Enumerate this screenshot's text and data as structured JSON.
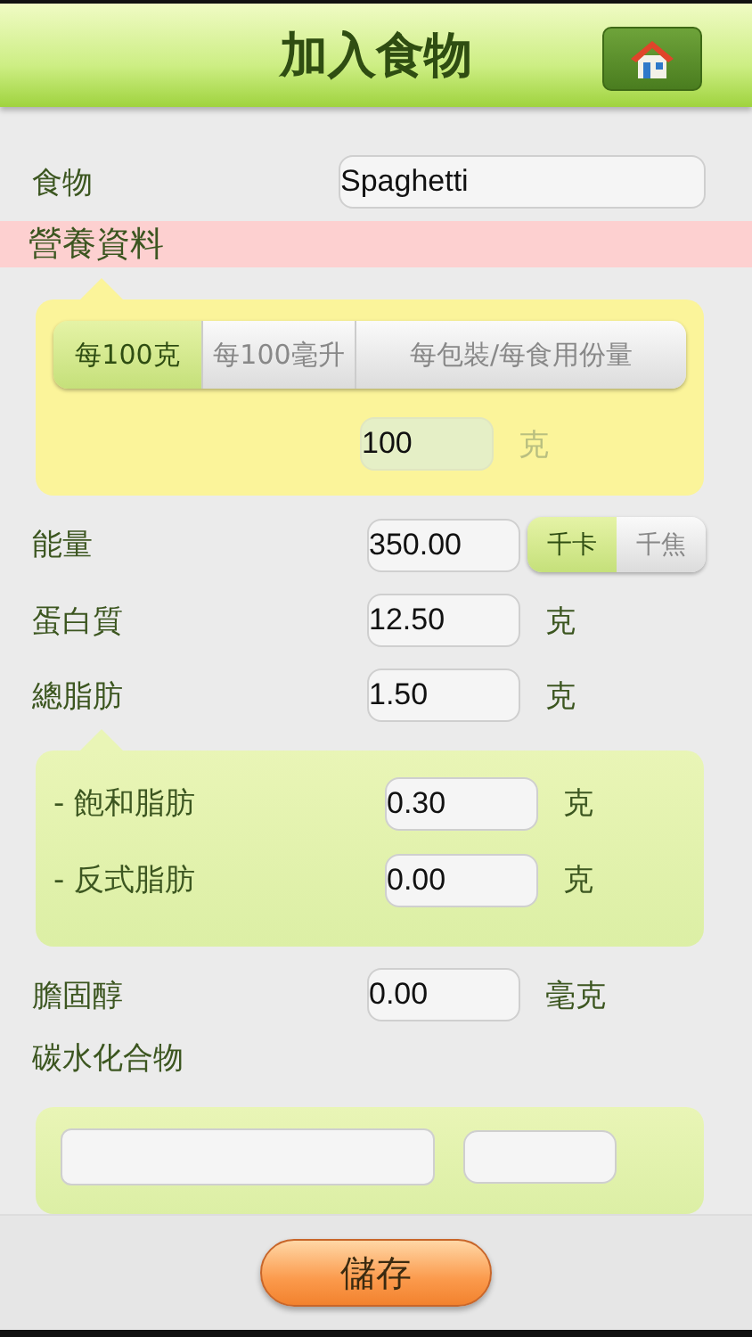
{
  "header": {
    "title": "加入食物"
  },
  "food": {
    "label": "食物",
    "value": "Spaghetti"
  },
  "section_title": "營養資料",
  "basis": {
    "tabs": [
      {
        "label": "每100克",
        "selected": true
      },
      {
        "label": "每100毫升",
        "selected": false
      },
      {
        "label": "每包裝/每食用份量",
        "selected": false
      }
    ],
    "amount": "100",
    "unit": "克",
    "unit_disabled": true
  },
  "nutrients": [
    {
      "kind": "toggle",
      "label": "能量",
      "value": "350.00",
      "units": [
        {
          "label": "千卡",
          "selected": true
        },
        {
          "label": "千焦",
          "selected": false
        }
      ]
    },
    {
      "kind": "field",
      "label": "蛋白質",
      "value": "12.50",
      "unit": "克"
    },
    {
      "kind": "group",
      "label": "總脂肪",
      "value": "1.50",
      "unit": "克",
      "children": [
        {
          "label": "- 飽和脂肪",
          "value": "0.30",
          "unit": "克"
        },
        {
          "label": "- 反式脂肪",
          "value": "0.00",
          "unit": "克"
        }
      ]
    },
    {
      "kind": "field",
      "label": "膽固醇",
      "value": "0.00",
      "unit": "毫克"
    },
    {
      "kind": "heading",
      "label": "碳水化合物",
      "expanded": true
    }
  ],
  "save_button": "儲存"
}
